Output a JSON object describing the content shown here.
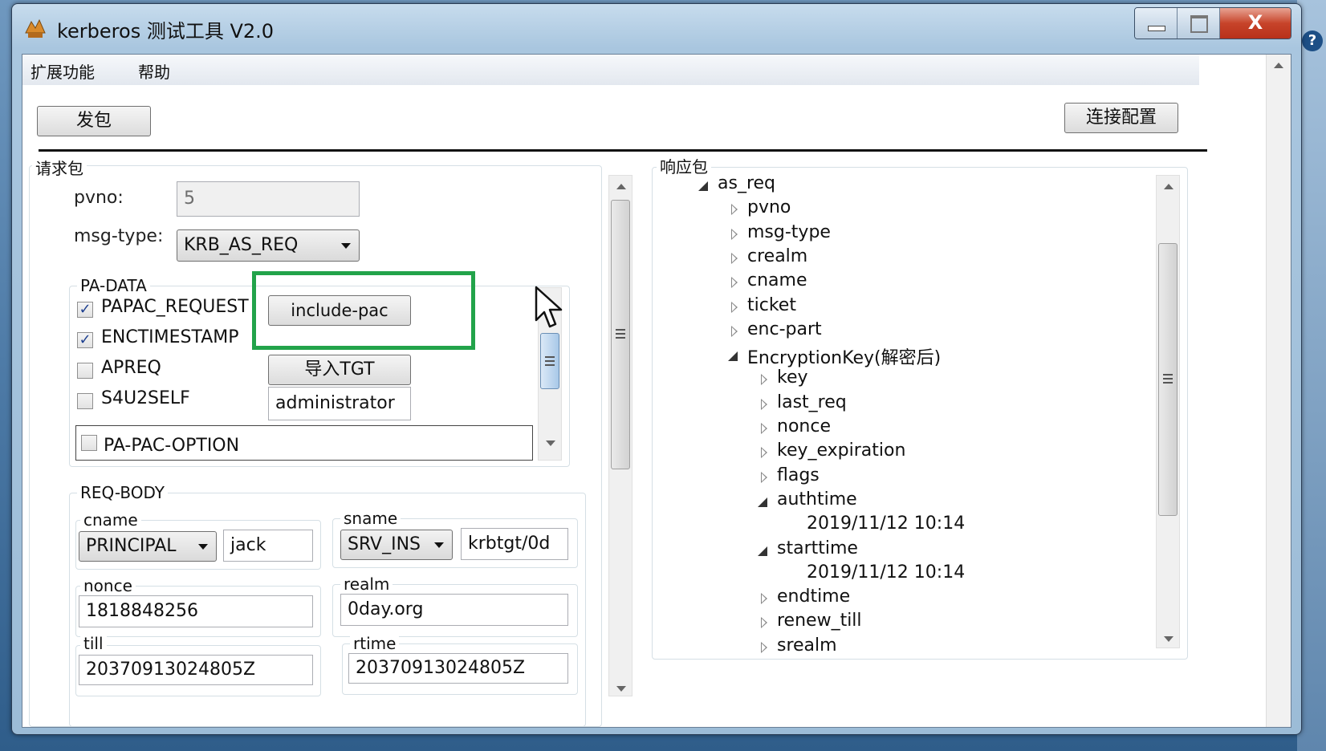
{
  "window": {
    "title": "kerberos 测试工具 V2.0",
    "close_glyph": "X"
  },
  "desktop": {
    "help_glyph": "?"
  },
  "menu": {
    "items": [
      "扩展功能",
      "帮助"
    ]
  },
  "toolbar": {
    "send_label": "发包",
    "connect_label": "连接配置"
  },
  "request": {
    "group_title": "请求包",
    "pvno_label": "pvno:",
    "pvno_value": "5",
    "msgtype_label": "msg-type:",
    "msgtype_value": "KRB_AS_REQ",
    "padata": {
      "title": "PA-DATA",
      "options": [
        {
          "label": "PAPAC_REQUEST",
          "checked": true
        },
        {
          "label": "ENCTIMESTAMP",
          "checked": true
        },
        {
          "label": "APREQ",
          "checked": false
        },
        {
          "label": "S4U2SELF",
          "checked": false
        }
      ],
      "check_glyph": "✓",
      "include_pac_label": "include-pac",
      "import_tgt_label": "导入TGT",
      "username_value": "administrator",
      "pa_pac_option_label": "PA-PAC-OPTION"
    },
    "reqbody": {
      "title": "REQ-BODY",
      "cname_title": "cname",
      "cname_type": "PRINCIPAL",
      "cname_value": "jack",
      "sname_title": "sname",
      "sname_type": "SRV_INS",
      "sname_value": "krbtgt/0d",
      "nonce_title": "nonce",
      "nonce_value": "1818848256",
      "realm_title": "realm",
      "realm_value": "0day.org",
      "till_title": "till",
      "till_value": "20370913024805Z",
      "rtime_title": "rtime",
      "rtime_value": "20370913024805Z"
    }
  },
  "response": {
    "group_title": "响应包",
    "tree": [
      {
        "label": "as_req",
        "state": "open"
      },
      {
        "label": "pvno",
        "state": "closed"
      },
      {
        "label": "msg-type",
        "state": "closed"
      },
      {
        "label": "crealm",
        "state": "closed"
      },
      {
        "label": "cname",
        "state": "closed"
      },
      {
        "label": "ticket",
        "state": "closed"
      },
      {
        "label": "enc-part",
        "state": "closed"
      },
      {
        "label": "EncryptionKey(解密后)",
        "state": "open"
      },
      {
        "label": "key",
        "state": "closed"
      },
      {
        "label": "last_req",
        "state": "closed"
      },
      {
        "label": "nonce",
        "state": "closed"
      },
      {
        "label": "key_expiration",
        "state": "closed"
      },
      {
        "label": "flags",
        "state": "closed"
      },
      {
        "label": "authtime",
        "state": "open"
      },
      {
        "label": "2019/11/12 10:14",
        "state": "leaf"
      },
      {
        "label": "starttime",
        "state": "open"
      },
      {
        "label": "2019/11/12 10:14",
        "state": "leaf"
      },
      {
        "label": "endtime",
        "state": "closed"
      },
      {
        "label": "renew_till",
        "state": "closed"
      },
      {
        "label": "srealm",
        "state": "closed"
      }
    ]
  },
  "colors": {
    "highlight": "#22a34a",
    "titlebar": "#a9c6df",
    "close_button": "#c7442a"
  }
}
